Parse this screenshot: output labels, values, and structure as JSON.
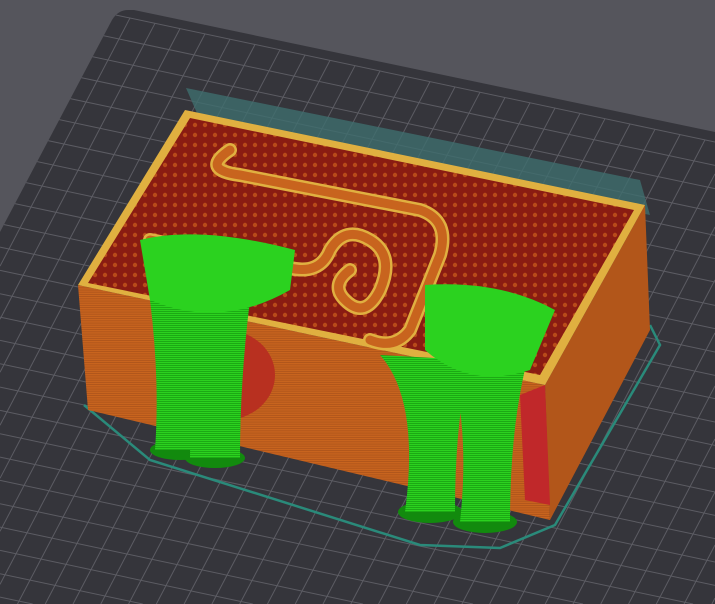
{
  "viewport": {
    "view": "slice-preview-3d",
    "colors": {
      "background": "#55555c",
      "bed": "#35353b",
      "grid": "#5c5c63",
      "wall": "#c8641e",
      "wall_dark": "#a44e14",
      "infill": "#8a1c12",
      "perimeter_edge": "#e0b040",
      "support": "#22c61a",
      "support_dark": "#128a0e",
      "skirt": "#2a8a7a",
      "travel_region": "#3f6e6e"
    }
  }
}
